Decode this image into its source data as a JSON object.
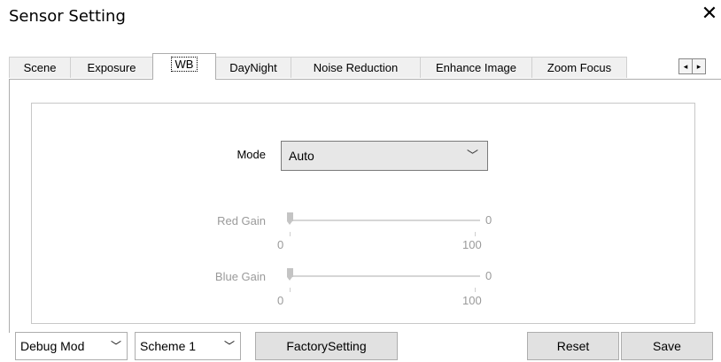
{
  "window": {
    "title": "Sensor Setting",
    "close_glyph": "✕"
  },
  "tabs": [
    {
      "label": "Scene"
    },
    {
      "label": "Exposure"
    },
    {
      "label": "WB",
      "active": true
    },
    {
      "label": "DayNight"
    },
    {
      "label": "Noise Reduction"
    },
    {
      "label": "Enhance Image"
    },
    {
      "label": "Zoom Focus"
    }
  ],
  "tab_scroll": {
    "left": "◂",
    "right": "▸"
  },
  "wb": {
    "mode_label": "Mode",
    "mode_value": "Auto",
    "red_gain": {
      "label": "Red Gain",
      "value": "0",
      "min": "0",
      "max": "100"
    },
    "blue_gain": {
      "label": "Blue Gain",
      "value": "0",
      "min": "0",
      "max": "100"
    }
  },
  "bottom": {
    "debug_mode": "Debug Mod ",
    "scheme": "Scheme 1",
    "factory_setting": "FactorySetting",
    "reset": "Reset",
    "save": "Save"
  },
  "icons": {
    "chevron": "chevron-down-icon",
    "close": "close-icon"
  }
}
